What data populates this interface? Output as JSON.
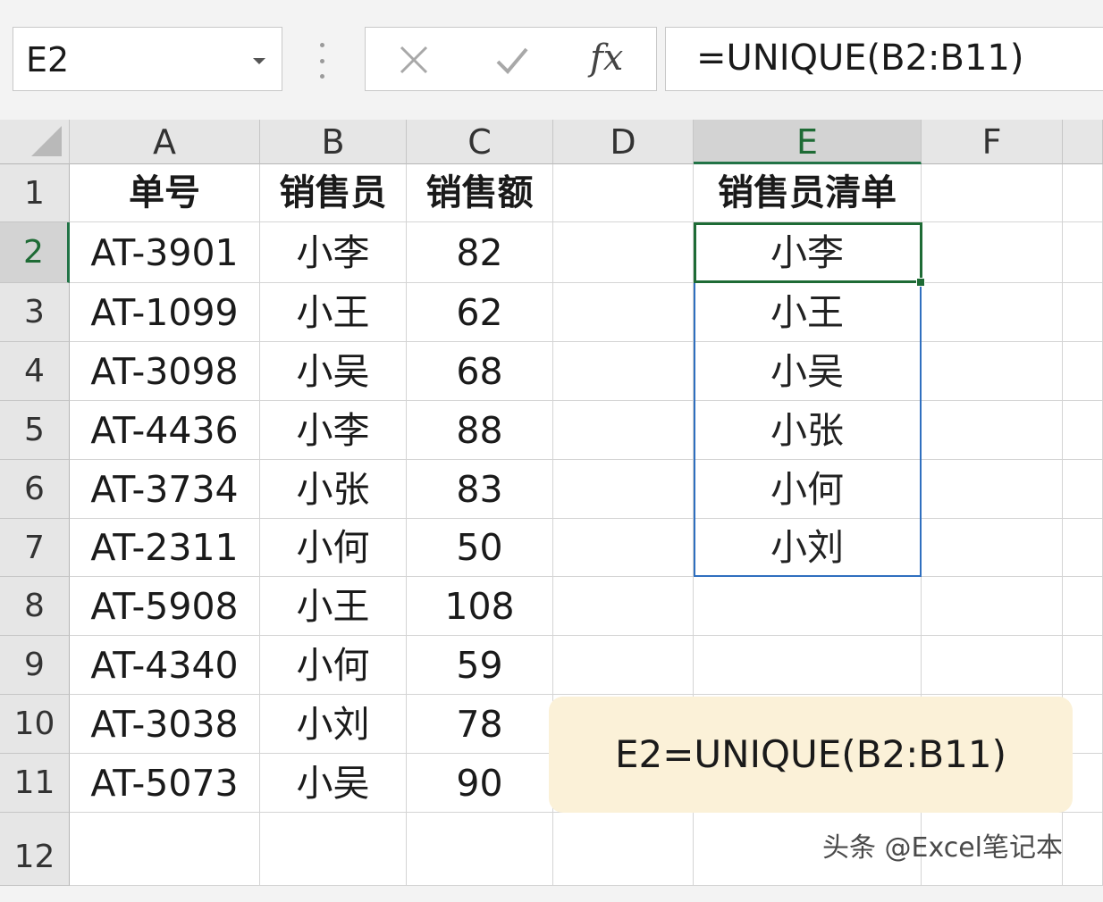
{
  "name_box": {
    "value": "E2"
  },
  "formula_bar": {
    "value": "=UNIQUE(B2:B11)",
    "fx_label": "fx"
  },
  "icons": {
    "cancel": "close-icon",
    "enter": "check-icon",
    "function": "fx-icon",
    "name_box_dropdown": "chevron-down-icon"
  },
  "colors": {
    "active_green": "#217346",
    "selection_blue": "#2f6fbf",
    "note_bg": "#fbf1d8"
  },
  "columns": [
    "A",
    "B",
    "C",
    "D",
    "E",
    "F"
  ],
  "rows": [
    "1",
    "2",
    "3",
    "4",
    "5",
    "6",
    "7",
    "8",
    "9",
    "10",
    "11",
    "12"
  ],
  "header_row": {
    "A": "单号",
    "B": "销售员",
    "C": "销售额",
    "E": "销售员清单"
  },
  "table": {
    "order_no": [
      "AT-3901",
      "AT-1099",
      "AT-3098",
      "AT-4436",
      "AT-3734",
      "AT-2311",
      "AT-5908",
      "AT-4340",
      "AT-3038",
      "AT-5073"
    ],
    "salesperson": [
      "小李",
      "小王",
      "小吴",
      "小李",
      "小张",
      "小何",
      "小王",
      "小何",
      "小刘",
      "小吴"
    ],
    "amount": [
      "82",
      "62",
      "68",
      "88",
      "83",
      "50",
      "108",
      "59",
      "78",
      "90"
    ]
  },
  "unique_list": [
    "小李",
    "小王",
    "小吴",
    "小张",
    "小何",
    "小刘"
  ],
  "active_cell": "E2",
  "note": {
    "text": "E2=UNIQUE(B2:B11)"
  },
  "watermark": {
    "text": "头条 @Excel笔记本"
  }
}
